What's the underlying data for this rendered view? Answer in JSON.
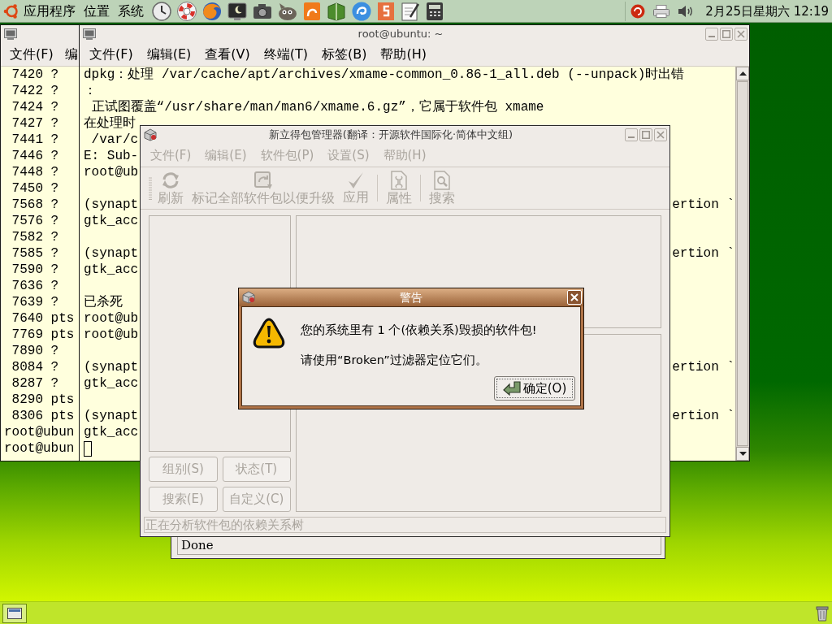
{
  "top_panel": {
    "menus": [
      "应用程序",
      "位置",
      "系统"
    ],
    "clock": "2月25日星期六 12:19"
  },
  "back_terminal": {
    "menus": [
      "文件(F)",
      "编"
    ],
    "lines": [
      " 7420 ?",
      " 7422 ?",
      " 7424 ?",
      " 7427 ?",
      " 7441 ?",
      " 7446 ?",
      " 7448 ?",
      " 7450 ?",
      " 7568 ?",
      " 7576 ?",
      " 7582 ?",
      " 7585 ?",
      " 7590 ?",
      " 7636 ?",
      " 7639 ?",
      " 7640 pts",
      " 7769 pts",
      " 7890 ?",
      " 8084 ?",
      " 8287 ?",
      " 8290 pts",
      " 8306 pts",
      "root@ubun",
      "root@ubun"
    ]
  },
  "front_terminal": {
    "title": "root@ubuntu: ~",
    "menus": [
      "文件(F)",
      "编辑(E)",
      "查看(V)",
      "终端(T)",
      "标签(B)",
      "帮助(H)"
    ],
    "lines": [
      {
        "kind": "text",
        "text": "dpkg：处理 /var/cache/apt/archives/xmame-common_0.86-1_all.deb (--unpack)时出错"
      },
      {
        "kind": "text",
        "text": "："
      },
      {
        "kind": "text",
        "text": " 正试图覆盖“/usr/share/man/man6/xmame.6.gz”，它属于软件包 xmame"
      },
      {
        "kind": "text",
        "text": "在处理时"
      },
      {
        "kind": "text",
        "text": " /var/c"
      },
      {
        "kind": "text",
        "text": "E: Sub-"
      },
      {
        "kind": "text",
        "text": "root@ub"
      },
      {
        "kind": "blank"
      },
      {
        "kind": "text",
        "text": "(synapt",
        "tail": "ertion `"
      },
      {
        "kind": "text",
        "text": "gtk_acc"
      },
      {
        "kind": "blank"
      },
      {
        "kind": "text",
        "text": "(synapt",
        "tail": "ertion `"
      },
      {
        "kind": "text",
        "text": "gtk_acc"
      },
      {
        "kind": "blank"
      },
      {
        "kind": "text",
        "text": "已杀死"
      },
      {
        "kind": "text",
        "text": "root@ub"
      },
      {
        "kind": "text",
        "text": "root@ub"
      },
      {
        "kind": "blank"
      },
      {
        "kind": "text",
        "text": "(synapt",
        "tail": "ertion `"
      },
      {
        "kind": "text",
        "text": "gtk_acc"
      },
      {
        "kind": "blank"
      },
      {
        "kind": "text",
        "text": "(synapt",
        "tail": "ertion `"
      },
      {
        "kind": "text",
        "text": "gtk_acc"
      },
      {
        "kind": "cursor"
      }
    ]
  },
  "progress_window": {
    "status": "Done"
  },
  "synaptic": {
    "title": "新立得包管理器(翻译：开源软件国际化·简体中文组)",
    "menus": [
      {
        "label": "文件(F)",
        "disabled": true
      },
      {
        "label": "编辑(E)",
        "disabled": true
      },
      {
        "label": "软件包(P)",
        "disabled": true
      },
      {
        "label": "设置(S)",
        "disabled": true
      },
      {
        "label": "帮助(H)",
        "disabled": true
      }
    ],
    "toolbar": [
      {
        "label": "刷新",
        "disabled": true
      },
      {
        "label": "标记全部软件包以便升级",
        "disabled": true
      },
      {
        "label": "应用",
        "disabled": true
      },
      {
        "label": "属性",
        "disabled": true
      },
      {
        "label": "搜索",
        "disabled": true
      }
    ],
    "filter_buttons": [
      {
        "label": "组别(S)",
        "disabled": true
      },
      {
        "label": "状态(T)",
        "disabled": true
      },
      {
        "label": "搜索(E)",
        "disabled": true
      },
      {
        "label": "自定义(C)",
        "disabled": true
      }
    ],
    "status": "正在分析软件包的依赖关系树"
  },
  "dialog": {
    "title": "警告",
    "messages": [
      "您的系统里有 1 个(依赖关系)毁损的软件包!",
      "请使用“Broken”过滤器定位它们。"
    ],
    "button": "确定(O)"
  }
}
